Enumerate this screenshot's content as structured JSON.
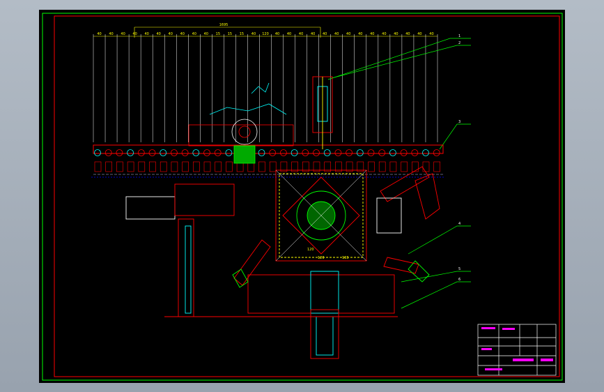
{
  "drawing": {
    "dimensions": {
      "top_overall": "1695",
      "top_chain": [
        "40",
        "40",
        "40",
        "40",
        "40",
        "40",
        "40",
        "40",
        "40",
        "40",
        "15",
        "15",
        "15",
        "40",
        "120",
        "40",
        "40",
        "40",
        "40",
        "40",
        "40",
        "40",
        "40",
        "40",
        "40",
        "40",
        "40",
        "40",
        "40"
      ],
      "mid_a": "120",
      "mid_b": "165",
      "mid_c": "120"
    },
    "callouts": [
      "1",
      "2",
      "3",
      "4",
      "5",
      "6"
    ],
    "title_block": {
      "rows": [
        "",
        "",
        "",
        "",
        "",
        ""
      ]
    },
    "colors": {
      "frame": "#00ff00",
      "structure": "#ff0000",
      "dimension": "#ffff00",
      "detail": "#00ffff",
      "hatch": "#00ff00",
      "accent": "#ff00ff",
      "white": "#ffffff",
      "grey": "#8080a0"
    }
  }
}
